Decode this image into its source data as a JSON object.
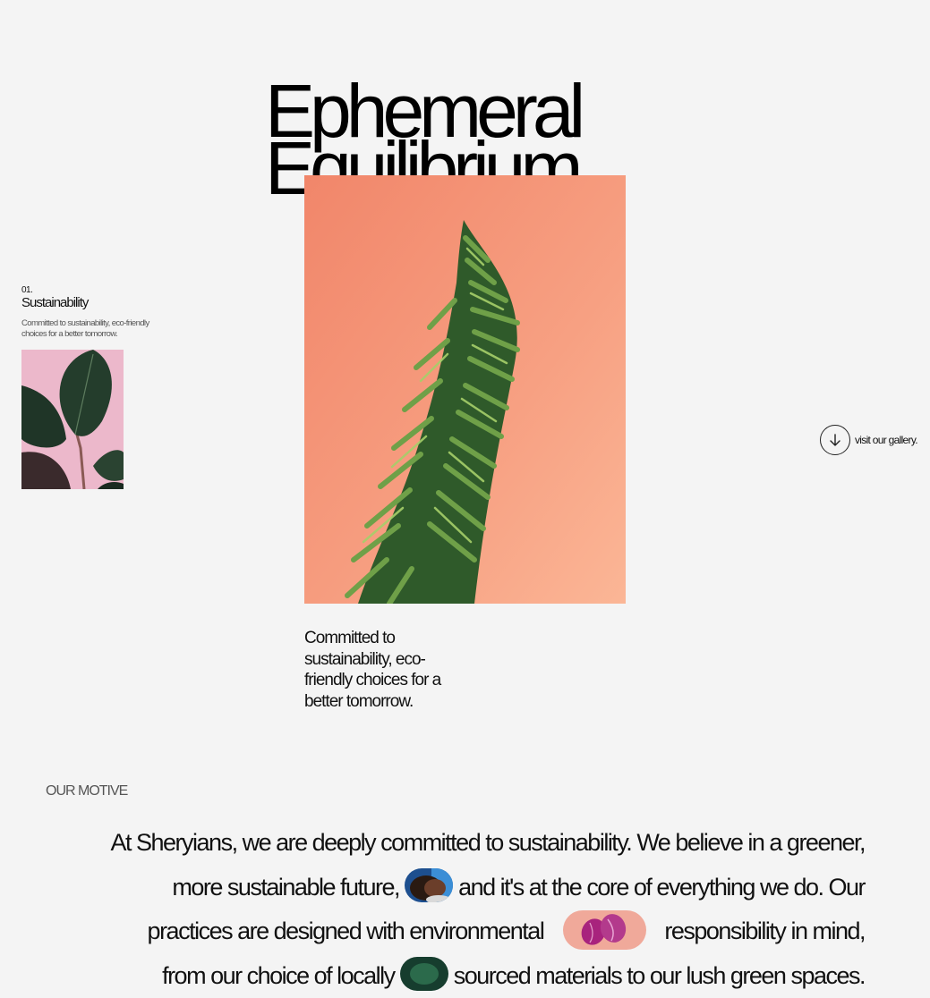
{
  "hero": {
    "title_line1": "Ephemeral",
    "title_line2": "Equilibrium.",
    "caption": "Committed to sustainability, eco-friendly choices for a better tomorrow.",
    "image_background": "#f7a184"
  },
  "side_card": {
    "number": "01.",
    "title": "Sustainability",
    "description": "Committed to sustainability, eco-friendly choices for a better tomorrow.",
    "image_background": "#eab7c9"
  },
  "gallery_link": {
    "icon": "arrow-down-icon",
    "label": "visit our gallery."
  },
  "motive": {
    "label": "OUR MOTIVE",
    "text_part1": "At Sheryians, we are deeply committed to sustainability. We believe in a greener, more sustainable future,",
    "text_part2": "and it's at the core of everything we do. Our practices are designed with environmental",
    "text_part3": "responsibility",
    "text_part4": "in mind, from our choice of locally",
    "text_part5": "sourced materials to our lush green spaces."
  }
}
